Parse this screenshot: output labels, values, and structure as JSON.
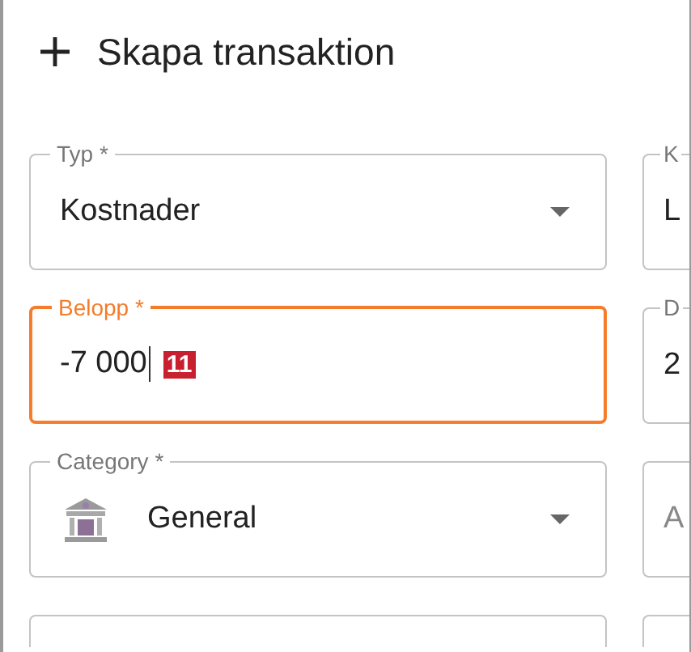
{
  "dialog": {
    "title": "Skapa transaktion"
  },
  "fields": [
    {
      "kind": "select",
      "label": "Typ *",
      "value": "Kostnader",
      "focused": false
    },
    {
      "kind": "text",
      "label": "K",
      "value": "L",
      "focused": false
    },
    {
      "kind": "text",
      "label": "Belopp *",
      "value": "-7 000",
      "focused": true,
      "marker": "11"
    },
    {
      "kind": "text",
      "label": "D",
      "value": "2",
      "focused": false
    },
    {
      "kind": "category-select",
      "label": "Category *",
      "value": "General",
      "focused": false
    },
    {
      "kind": "text",
      "placeholder": "A",
      "focused": false
    },
    {
      "kind": "text",
      "focused": false
    },
    {
      "kind": "text",
      "focused": false
    }
  ]
}
